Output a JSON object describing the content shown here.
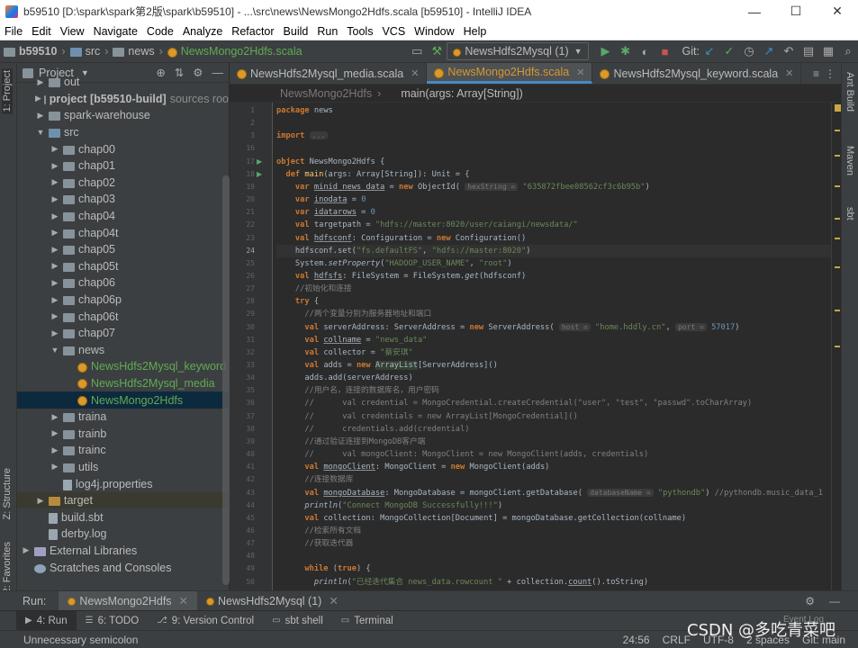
{
  "title": "b59510 [D:\\spark\\spark第2版\\spark\\b59510] - ...\\src\\news\\NewsMongo2Hdfs.scala [b59510] - IntelliJ IDEA",
  "window_controls": {
    "minimize": "—",
    "maximize": "☐",
    "close": "✕"
  },
  "menu": [
    "File",
    "Edit",
    "View",
    "Navigate",
    "Code",
    "Analyze",
    "Refactor",
    "Build",
    "Run",
    "Tools",
    "VCS",
    "Window",
    "Help"
  ],
  "breadcrumb": {
    "project": "b59510",
    "src": "src",
    "pkg": "news",
    "file": "NewsMongo2Hdfs.scala"
  },
  "toolbar": {
    "run_config": "NewsHdfs2Mysql (1)",
    "git_label": "Git:"
  },
  "left_strip": {
    "project": "1: Project",
    "structure": "Z: Structure",
    "favorites": "2: Favorites"
  },
  "right_strip": {
    "ant": "Ant Build",
    "maven": "Maven",
    "sbt": "sbt"
  },
  "project_panel": {
    "title": "Project"
  },
  "tree": [
    {
      "indent": 1,
      "arrow": "▶",
      "kind": "fold",
      "label": "out"
    },
    {
      "indent": 1,
      "arrow": "▶",
      "kind": "fold",
      "label": "project [b59510-build]",
      "suffix": "sources roo"
    },
    {
      "indent": 1,
      "arrow": "▶",
      "kind": "fold",
      "label": "spark-warehouse"
    },
    {
      "indent": 1,
      "arrow": "▼",
      "kind": "foldb",
      "label": "src"
    },
    {
      "indent": 2,
      "arrow": "▶",
      "kind": "fold",
      "label": "chap00"
    },
    {
      "indent": 2,
      "arrow": "▶",
      "kind": "fold",
      "label": "chap01"
    },
    {
      "indent": 2,
      "arrow": "▶",
      "kind": "fold",
      "label": "chap02"
    },
    {
      "indent": 2,
      "arrow": "▶",
      "kind": "fold",
      "label": "chap03"
    },
    {
      "indent": 2,
      "arrow": "▶",
      "kind": "fold",
      "label": "chap04"
    },
    {
      "indent": 2,
      "arrow": "▶",
      "kind": "fold",
      "label": "chap04t"
    },
    {
      "indent": 2,
      "arrow": "▶",
      "kind": "fold",
      "label": "chap05"
    },
    {
      "indent": 2,
      "arrow": "▶",
      "kind": "fold",
      "label": "chap05t"
    },
    {
      "indent": 2,
      "arrow": "▶",
      "kind": "fold",
      "label": "chap06"
    },
    {
      "indent": 2,
      "arrow": "▶",
      "kind": "fold",
      "label": "chap06p"
    },
    {
      "indent": 2,
      "arrow": "▶",
      "kind": "fold",
      "label": "chap06t"
    },
    {
      "indent": 2,
      "arrow": "▶",
      "kind": "fold",
      "label": "chap07"
    },
    {
      "indent": 2,
      "arrow": "▼",
      "kind": "fold",
      "label": "news"
    },
    {
      "indent": 3,
      "arrow": "",
      "kind": "obj",
      "label": "NewsHdfs2Mysql_keyword",
      "green": true
    },
    {
      "indent": 3,
      "arrow": "",
      "kind": "obj",
      "label": "NewsHdfs2Mysql_media",
      "green": true
    },
    {
      "indent": 3,
      "arrow": "",
      "kind": "obj",
      "label": "NewsMongo2Hdfs",
      "green": true,
      "selected": true
    },
    {
      "indent": 2,
      "arrow": "▶",
      "kind": "fold",
      "label": "traina"
    },
    {
      "indent": 2,
      "arrow": "▶",
      "kind": "fold",
      "label": "trainb"
    },
    {
      "indent": 2,
      "arrow": "▶",
      "kind": "fold",
      "label": "trainc"
    },
    {
      "indent": 2,
      "arrow": "▶",
      "kind": "fold",
      "label": "utils"
    },
    {
      "indent": 2,
      "arrow": "",
      "kind": "file",
      "label": "log4j.properties"
    },
    {
      "indent": 1,
      "arrow": "▶",
      "kind": "foldo",
      "label": "target",
      "target": true
    },
    {
      "indent": 1,
      "arrow": "",
      "kind": "file",
      "label": "build.sbt"
    },
    {
      "indent": 1,
      "arrow": "",
      "kind": "file",
      "label": "derby.log"
    },
    {
      "indent": 0,
      "arrow": "▶",
      "kind": "lib",
      "label": "External Libraries"
    },
    {
      "indent": 0,
      "arrow": "",
      "kind": "scratch",
      "label": "Scratches and Consoles"
    }
  ],
  "editor_tabs": [
    {
      "label": "NewsHdfs2Mysql_media.scala",
      "active": false
    },
    {
      "label": "NewsMongo2Hdfs.scala",
      "active": true
    },
    {
      "label": "NewsHdfs2Mysql_keyword.scala",
      "active": false
    }
  ],
  "editor_breadcrumb": {
    "obj": "NewsMongo2Hdfs",
    "method": "main(args: Array[String])"
  },
  "code_lines": [
    {
      "n": "1",
      "html": "<span class=\"kw\">package</span> news"
    },
    {
      "n": "2",
      "html": ""
    },
    {
      "n": "3",
      "html": "<span class=\"kw\">import</span> <span class=\"hint\">...</span>"
    },
    {
      "n": "16",
      "html": ""
    },
    {
      "n": "17",
      "html": "<span class=\"kw\">object</span> NewsMongo2Hdfs {",
      "run": true
    },
    {
      "n": "18",
      "html": "  <span class=\"kw\">def</span> <span class=\"fn\">main</span>(args: Array[String]): Unit = {",
      "run": true
    },
    {
      "n": "19",
      "html": "    <span class=\"kw\">var</span> <span class=\"ul\">minid_news_data</span> = <span class=\"kw\">new</span> ObjectId( <span class=\"hint\">hexString =</span> <span class=\"str\">\"635872fbee08562cf3c6b95b\"</span>)"
    },
    {
      "n": "20",
      "html": "    <span class=\"kw\">var</span> <span class=\"ul\">inodata</span> = <span class=\"num\">0</span>"
    },
    {
      "n": "21",
      "html": "    <span class=\"kw\">var</span> <span class=\"ul\">idatarows</span> = <span class=\"num\">0</span>"
    },
    {
      "n": "22",
      "html": "    <span class=\"kw\">val</span> targetpath = <span class=\"str\">\"hdfs://master:8020/user/caiangi/newsdata/\"</span>"
    },
    {
      "n": "23",
      "html": "    <span class=\"kw\">val</span> <span class=\"ul\">hdfsconf</span>: Configuration = <span class=\"kw\">new</span> Configuration()"
    },
    {
      "n": "24",
      "html": "    hdfsconf.set(<span class=\"str\">\"fs.defaultFS\"</span>, <span class=\"str\">\"hdfs://master:8020\"</span>)",
      "current": true
    },
    {
      "n": "25",
      "html": "    System.<span class=\"itl\">setProperty</span>(<span class=\"str\">\"HADOOP_USER_NAME\"</span>, <span class=\"str\">\"root\"</span>)"
    },
    {
      "n": "26",
      "html": "    <span class=\"kw\">val</span> <span class=\"ul\">hdfsfs</span>: FileSystem = FileSystem.<span class=\"itl\">get</span>(hdfsconf)"
    },
    {
      "n": "27",
      "html": "    <span class=\"cm\">//初始化和连接</span>"
    },
    {
      "n": "28",
      "html": "    <span class=\"kw\">try</span> {"
    },
    {
      "n": "29",
      "html": "      <span class=\"cm\">//两个变量分别为服务器地址和端口</span>"
    },
    {
      "n": "30",
      "html": "      <span class=\"kw\">val</span> serverAddress: ServerAddress = <span class=\"kw\">new</span> ServerAddress( <span class=\"hint\">host =</span> <span class=\"str\">\"home.hddly.cn\"</span>, <span class=\"hint\">port =</span> <span class=\"num\">57017</span>)"
    },
    {
      "n": "31",
      "html": "      <span class=\"kw\">val</span> <span class=\"ul\">collname</span> = <span class=\"str\">\"news_data\"</span>"
    },
    {
      "n": "32",
      "html": "      <span class=\"kw\">val</span> collector = <span class=\"str\">\"蔡安琪\"</span>"
    },
    {
      "n": "33",
      "html": "      <span class=\"kw\">val</span> adds = <span class=\"kw\">new</span> <span class=\"hl\">ArrayList</span>[ServerAddress]()"
    },
    {
      "n": "34",
      "html": "      adds.add(serverAddress)"
    },
    {
      "n": "35",
      "html": "      <span class=\"cm\">//用户名，连接的数据库名，用户密码</span>"
    },
    {
      "n": "36",
      "html": "      <span class=\"cm\">//      val credential = MongoCredential.createCredential(\"user\", \"test\", \"passwd\".toCharArray)</span>"
    },
    {
      "n": "37",
      "html": "      <span class=\"cm\">//      val credentials = new ArrayList[MongoCredential]()</span>"
    },
    {
      "n": "38",
      "html": "      <span class=\"cm\">//      credentials.add(credential)</span>"
    },
    {
      "n": "39",
      "html": "      <span class=\"cm\">//通过验证连接到MongoDB客户端</span>"
    },
    {
      "n": "40",
      "html": "      <span class=\"cm\">//      val mongoClient: MongoClient = new MongoClient(adds, credentials)</span>"
    },
    {
      "n": "41",
      "html": "      <span class=\"kw\">val</span> <span class=\"ul\">mongoClient</span>: MongoClient = <span class=\"kw\">new</span> MongoClient(adds)"
    },
    {
      "n": "42",
      "html": "      <span class=\"cm\">//连接数据库</span>"
    },
    {
      "n": "43",
      "html": "      <span class=\"kw\">val</span> <span class=\"ul\">mongoDatabase</span>: MongoDatabase = mongoClient.getDatabase( <span class=\"hint\">databaseName =</span> <span class=\"str\">\"pythondb\"</span>) <span class=\"cm\">//pythondb.music_data_1</span>"
    },
    {
      "n": "44",
      "html": "      <span class=\"itl\">println</span>(<span class=\"str\">\"Connect MongoDB Successfully!!!\"</span>)"
    },
    {
      "n": "45",
      "html": "      <span class=\"kw\">val</span> collection: MongoCollection[Document] = mongoDatabase.getCollection(collname)"
    },
    {
      "n": "46",
      "html": "      <span class=\"cm\">//检索所有文档</span>"
    },
    {
      "n": "47",
      "html": "      <span class=\"cm\">//获取迭代器</span>"
    },
    {
      "n": "48",
      "html": ""
    },
    {
      "n": "49",
      "html": "      <span class=\"kw\">while</span> (<span class=\"kw\">true</span>) {"
    },
    {
      "n": "50",
      "html": "        <span class=\"itl\">println</span>(<span class=\"str\">\"已经迭代集合 news_data.rowcount \"</span> + collection.<span class=\"ul\">count</span>().toString)"
    }
  ],
  "run_bar": {
    "label": "Run:",
    "tab1": "NewsMongo2Hdfs",
    "tab2": "NewsHdfs2Mysql (1)"
  },
  "tool_windows": [
    {
      "label": "4: Run",
      "active": true
    },
    {
      "label": "6: TODO",
      "active": false
    },
    {
      "label": "9: Version Control",
      "active": false
    },
    {
      "label": "sbt shell",
      "active": false
    },
    {
      "label": "Terminal",
      "active": false
    }
  ],
  "status": {
    "message": "Unnecessary semicolon",
    "position": "24:56",
    "line_sep": "CRLF",
    "encoding": "UTF-8",
    "indent": "2 spaces",
    "git": "Git: main"
  },
  "watermark": "CSDN @多吃青菜吧",
  "event_log": "Event Log"
}
